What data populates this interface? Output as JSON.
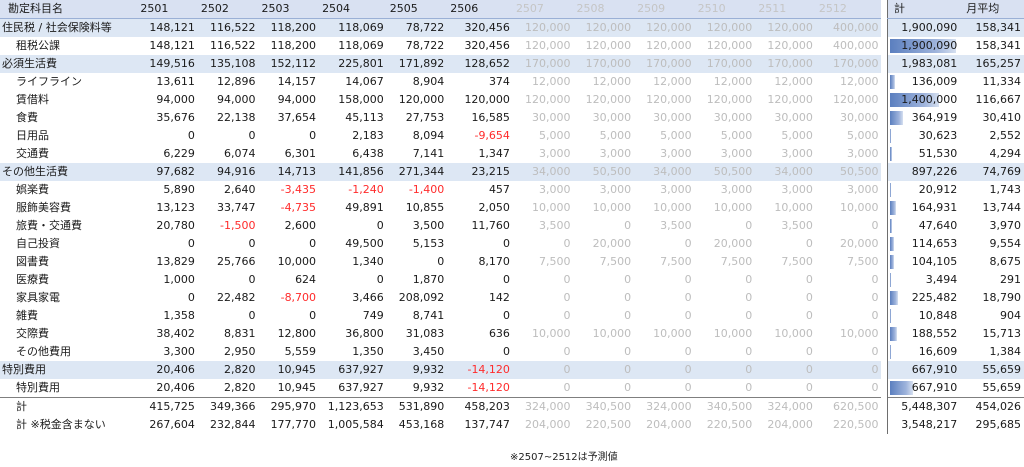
{
  "header": {
    "name": "勘定科目名",
    "months": [
      "2501",
      "2502",
      "2503",
      "2504",
      "2505",
      "2506",
      "2507",
      "2508",
      "2509",
      "2510",
      "2511",
      "2512"
    ],
    "total": "計",
    "avg": "月平均"
  },
  "actual_months": 6,
  "bar_max": 1900090,
  "rows": [
    {
      "level": 0,
      "category": true,
      "name": "住民税 / 社会保険料等",
      "values": [
        "148,121",
        "116,522",
        "118,200",
        "118,069",
        "78,722",
        "320,456",
        "120,000",
        "120,000",
        "120,000",
        "120,000",
        "120,000",
        "400,000"
      ],
      "total": "1,900,090",
      "avg": "158,341",
      "total_num": 1900090
    },
    {
      "level": 1,
      "category": false,
      "name": "租税公課",
      "values": [
        "148,121",
        "116,522",
        "118,200",
        "118,069",
        "78,722",
        "320,456",
        "120,000",
        "120,000",
        "120,000",
        "120,000",
        "120,000",
        "400,000"
      ],
      "total": "1,900,090",
      "avg": "158,341",
      "total_num": 1900090
    },
    {
      "level": 0,
      "category": true,
      "name": "必須生活費",
      "values": [
        "149,516",
        "135,108",
        "152,112",
        "225,801",
        "171,892",
        "128,652",
        "170,000",
        "170,000",
        "170,000",
        "170,000",
        "170,000",
        "170,000"
      ],
      "total": "1,983,081",
      "avg": "165,257",
      "total_num": 1983081
    },
    {
      "level": 1,
      "category": false,
      "name": "ライフライン",
      "values": [
        "13,611",
        "12,896",
        "14,157",
        "14,067",
        "8,904",
        "374",
        "12,000",
        "12,000",
        "12,000",
        "12,000",
        "12,000",
        "12,000"
      ],
      "total": "136,009",
      "avg": "11,334",
      "total_num": 136009
    },
    {
      "level": 1,
      "category": false,
      "name": "賃借料",
      "values": [
        "94,000",
        "94,000",
        "94,000",
        "158,000",
        "120,000",
        "120,000",
        "120,000",
        "120,000",
        "120,000",
        "120,000",
        "120,000",
        "120,000"
      ],
      "total": "1,400,000",
      "avg": "116,667",
      "total_num": 1400000
    },
    {
      "level": 1,
      "category": false,
      "name": "食費",
      "values": [
        "35,676",
        "22,138",
        "37,654",
        "45,113",
        "27,753",
        "16,585",
        "30,000",
        "30,000",
        "30,000",
        "30,000",
        "30,000",
        "30,000"
      ],
      "total": "364,919",
      "avg": "30,410",
      "total_num": 364919
    },
    {
      "level": 1,
      "category": false,
      "name": "日用品",
      "values": [
        "0",
        "0",
        "0",
        "2,183",
        "8,094",
        "-9,654",
        "5,000",
        "5,000",
        "5,000",
        "5,000",
        "5,000",
        "5,000"
      ],
      "total": "30,623",
      "avg": "2,552",
      "total_num": 30623
    },
    {
      "level": 1,
      "category": false,
      "name": "交通費",
      "values": [
        "6,229",
        "6,074",
        "6,301",
        "6,438",
        "7,141",
        "1,347",
        "3,000",
        "3,000",
        "3,000",
        "3,000",
        "3,000",
        "3,000"
      ],
      "total": "51,530",
      "avg": "4,294",
      "total_num": 51530
    },
    {
      "level": 0,
      "category": true,
      "name": "その他生活費",
      "values": [
        "97,682",
        "94,916",
        "14,713",
        "141,856",
        "271,344",
        "23,215",
        "34,000",
        "50,500",
        "34,000",
        "50,500",
        "34,000",
        "50,500"
      ],
      "total": "897,226",
      "avg": "74,769",
      "total_num": 897226
    },
    {
      "level": 1,
      "category": false,
      "name": "娯楽費",
      "values": [
        "5,890",
        "2,640",
        "-3,435",
        "-1,240",
        "-1,400",
        "457",
        "3,000",
        "3,000",
        "3,000",
        "3,000",
        "3,000",
        "3,000"
      ],
      "total": "20,912",
      "avg": "1,743",
      "total_num": 20912
    },
    {
      "level": 1,
      "category": false,
      "name": "服飾美容費",
      "values": [
        "13,123",
        "33,747",
        "-4,735",
        "49,891",
        "10,855",
        "2,050",
        "10,000",
        "10,000",
        "10,000",
        "10,000",
        "10,000",
        "10,000"
      ],
      "total": "164,931",
      "avg": "13,744",
      "total_num": 164931
    },
    {
      "level": 1,
      "category": false,
      "name": "旅費・交通費",
      "values": [
        "20,780",
        "-1,500",
        "2,600",
        "0",
        "3,500",
        "11,760",
        "3,500",
        "0",
        "3,500",
        "0",
        "3,500",
        "0"
      ],
      "total": "47,640",
      "avg": "3,970",
      "total_num": 47640
    },
    {
      "level": 1,
      "category": false,
      "name": "自己投資",
      "values": [
        "0",
        "0",
        "0",
        "49,500",
        "5,153",
        "0",
        "0",
        "20,000",
        "0",
        "20,000",
        "0",
        "20,000"
      ],
      "total": "114,653",
      "avg": "9,554",
      "total_num": 114653
    },
    {
      "level": 1,
      "category": false,
      "name": "図書費",
      "values": [
        "13,829",
        "25,766",
        "10,000",
        "1,340",
        "0",
        "8,170",
        "7,500",
        "7,500",
        "7,500",
        "7,500",
        "7,500",
        "7,500"
      ],
      "total": "104,105",
      "avg": "8,675",
      "total_num": 104105
    },
    {
      "level": 1,
      "category": false,
      "name": "医療費",
      "values": [
        "1,000",
        "0",
        "624",
        "0",
        "1,870",
        "0",
        "0",
        "0",
        "0",
        "0",
        "0",
        "0"
      ],
      "total": "3,494",
      "avg": "291",
      "total_num": 3494
    },
    {
      "level": 1,
      "category": false,
      "name": "家具家電",
      "values": [
        "0",
        "22,482",
        "-8,700",
        "3,466",
        "208,092",
        "142",
        "0",
        "0",
        "0",
        "0",
        "0",
        "0"
      ],
      "total": "225,482",
      "avg": "18,790",
      "total_num": 225482
    },
    {
      "level": 1,
      "category": false,
      "name": "雑費",
      "values": [
        "1,358",
        "0",
        "0",
        "749",
        "8,741",
        "0",
        "0",
        "0",
        "0",
        "0",
        "0",
        "0"
      ],
      "total": "10,848",
      "avg": "904",
      "total_num": 10848
    },
    {
      "level": 1,
      "category": false,
      "name": "交際費",
      "values": [
        "38,402",
        "8,831",
        "12,800",
        "36,800",
        "31,083",
        "636",
        "10,000",
        "10,000",
        "10,000",
        "10,000",
        "10,000",
        "10,000"
      ],
      "total": "188,552",
      "avg": "15,713",
      "total_num": 188552
    },
    {
      "level": 1,
      "category": false,
      "name": "その他費用",
      "values": [
        "3,300",
        "2,950",
        "5,559",
        "1,350",
        "3,450",
        "0",
        "0",
        "0",
        "0",
        "0",
        "0",
        "0"
      ],
      "total": "16,609",
      "avg": "1,384",
      "total_num": 16609
    },
    {
      "level": 0,
      "category": true,
      "name": "特別費用",
      "values": [
        "20,406",
        "2,820",
        "10,945",
        "637,927",
        "9,932",
        "-14,120",
        "0",
        "0",
        "0",
        "0",
        "0",
        "0"
      ],
      "total": "667,910",
      "avg": "55,659",
      "total_num": 667910
    },
    {
      "level": 1,
      "category": false,
      "name": "特別費用",
      "values": [
        "20,406",
        "2,820",
        "10,945",
        "637,927",
        "9,932",
        "-14,120",
        "0",
        "0",
        "0",
        "0",
        "0",
        "0"
      ],
      "total": "667,910",
      "avg": "55,659",
      "total_num": 667910
    }
  ],
  "totals": [
    {
      "name": "計",
      "values": [
        "415,725",
        "349,366",
        "295,970",
        "1,123,653",
        "531,890",
        "458,203",
        "324,000",
        "340,500",
        "324,000",
        "340,500",
        "324,000",
        "620,500"
      ],
      "total": "5,448,307",
      "avg": "454,026"
    },
    {
      "name": "計 ※税金含まない",
      "values": [
        "267,604",
        "232,844",
        "177,770",
        "1,005,584",
        "453,168",
        "137,747",
        "204,000",
        "220,500",
        "204,000",
        "220,500",
        "204,000",
        "220,500"
      ],
      "total": "3,548,217",
      "avg": "295,685"
    }
  ],
  "footnote": "※2507~2512は予測値"
}
